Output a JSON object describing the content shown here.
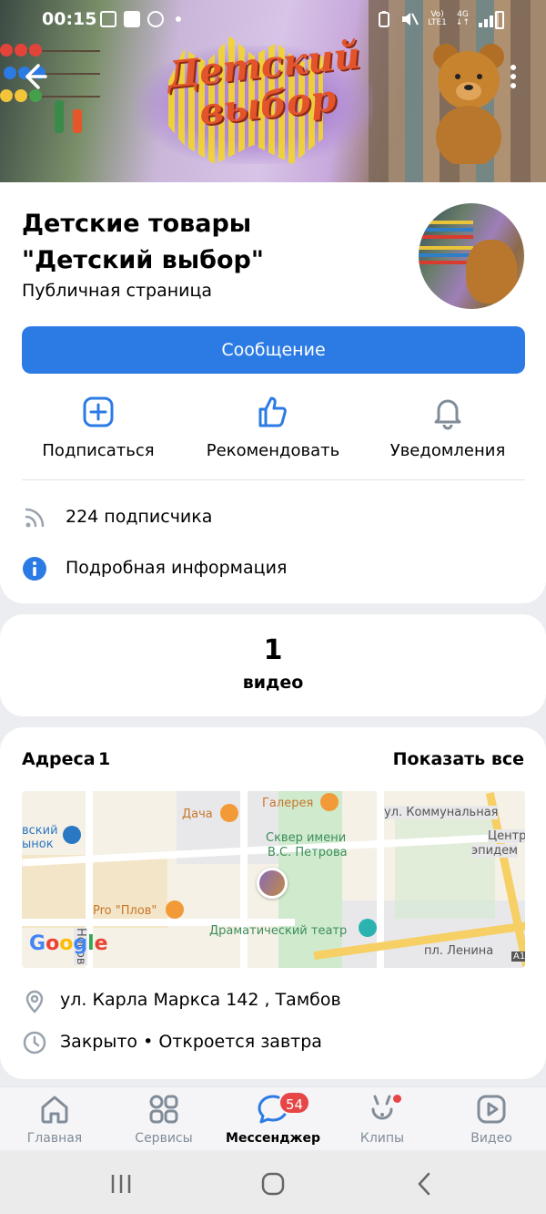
{
  "status_bar": {
    "time": "00:15",
    "network": "4G",
    "lte": "LTE1",
    "volte": "Vo)"
  },
  "cover": {
    "logo_text_line1": "Детский",
    "logo_text_line2": "выбор"
  },
  "page": {
    "title": "Детские товары \"Детский выбор\"",
    "subtitle": "Публичная страница",
    "message_button": "Сообщение"
  },
  "actions": {
    "subscribe": "Подписаться",
    "recommend": "Рекомендовать",
    "notifications": "Уведомления"
  },
  "info": {
    "subscribers": "224 подписчика",
    "details": "Подробная информация"
  },
  "videos": {
    "count": "1",
    "label": "видео"
  },
  "addresses": {
    "title": "Адреса",
    "count": "1",
    "show_all": "Показать все",
    "street": "ул. Карла Маркса 142 , Тамбов",
    "hours": "Закрыто • Откроется завтра"
  },
  "map": {
    "labels": {
      "dacha": "Дача",
      "gallery": "Галерея",
      "street_kommunalnaya": "ул. Коммунальная",
      "square": "Сквер имени",
      "square2": "В.С. Петрова",
      "market": "вский",
      "market2": "ынок",
      "center": "Центр",
      "center2": "эпидем",
      "plov": "Pro \"Плов\"",
      "theatre": "Драматический театр",
      "lenina": "пл. Ленина",
      "nosov": "Носов",
      "a1": "A1",
      "google": "Google"
    }
  },
  "bottom_nav": {
    "home": "Главная",
    "services": "Сервисы",
    "messenger": "Мессенджер",
    "messenger_badge": "54",
    "clips": "Клипы",
    "video": "Видео"
  },
  "colors": {
    "accent": "#2c7be5",
    "badge": "#e64646",
    "icon_blue": "#2c7be5",
    "icon_gray": "#818c99"
  }
}
